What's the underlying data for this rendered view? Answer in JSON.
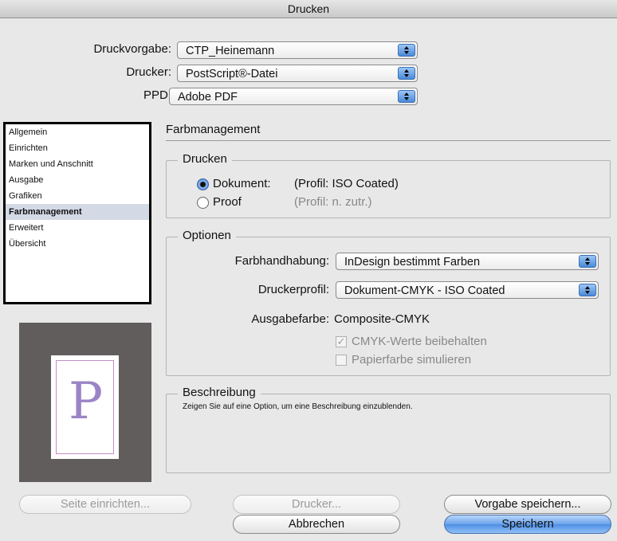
{
  "window": {
    "title": "Drucken"
  },
  "header": {
    "preset_label": "Druckvorgabe:",
    "preset_value": "CTP_Heinemann",
    "printer_label": "Drucker:",
    "printer_value": "PostScript®-Datei",
    "ppd_label": "PPD:",
    "ppd_value": "Adobe PDF"
  },
  "sidebar": {
    "items": [
      {
        "label": "Allgemein"
      },
      {
        "label": "Einrichten"
      },
      {
        "label": "Marken und Anschnitt"
      },
      {
        "label": "Ausgabe"
      },
      {
        "label": "Grafiken"
      },
      {
        "label": "Farbmanagement"
      },
      {
        "label": "Erweitert"
      },
      {
        "label": "Übersicht"
      }
    ],
    "selected": "Farbmanagement"
  },
  "preview": {
    "glyph": "P"
  },
  "main": {
    "section_title": "Farbmanagement",
    "print_group": {
      "title": "Drucken",
      "document_label": "Dokument:",
      "document_profile": "(Profil: ISO Coated)",
      "proof_label": "Proof",
      "proof_profile": "(Profil: n. zutr.)"
    },
    "options_group": {
      "title": "Optionen",
      "color_handling_label": "Farbhandhabung:",
      "color_handling_value": "InDesign bestimmt Farben",
      "printer_profile_label": "Druckerprofil:",
      "printer_profile_value": "Dokument-CMYK - ISO Coated",
      "output_color_label": "Ausgabefarbe:",
      "output_color_value": "Composite-CMYK",
      "preserve_cmyk_label": "CMYK-Werte beibehalten",
      "simulate_paper_label": "Papierfarbe simulieren"
    },
    "description_group": {
      "title": "Beschreibung",
      "text": "Zeigen Sie auf eine Option, um eine Beschreibung einzublenden."
    }
  },
  "footer": {
    "page_setup_label": "Seite einrichten...",
    "printer_label": "Drucker...",
    "save_preset_label": "Vorgabe speichern...",
    "cancel_label": "Abbrechen",
    "save_label": "Speichern"
  },
  "colors": {
    "accent": "#4f8fe3",
    "selection": "#d4d9e6",
    "preview_bg": "#605d5c",
    "glyph": "#9b84c6"
  }
}
